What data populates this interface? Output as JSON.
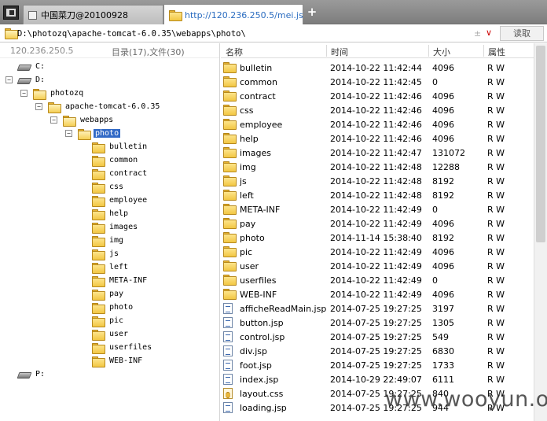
{
  "tabs": [
    {
      "label": "中国菜刀@20100928",
      "active": false
    },
    {
      "label": "http://120.236.250.5/mei.jsp",
      "active": true
    }
  ],
  "new_tab": "+",
  "path": {
    "value": "D:\\photozq\\apache-tomcat-6.0.35\\webapps\\photo\\",
    "separator": "±",
    "dropdown": "∨",
    "read_button": "读取"
  },
  "left_panel": {
    "ip": "120.236.250.5",
    "count": "目录(17),文件(30)",
    "tree": {
      "drive_c": "C:",
      "drive_d": "D:",
      "photozq": "photozq",
      "tomcat": "apache-tomcat-6.0.35",
      "webapps": "webapps",
      "photo": "photo",
      "children": [
        "bulletin",
        "common",
        "contract",
        "css",
        "employee",
        "help",
        "images",
        "img",
        "js",
        "left",
        "META-INF",
        "pay",
        "photo",
        "pic",
        "user",
        "userfiles",
        "WEB-INF"
      ],
      "drive_p": "P:"
    }
  },
  "columns": {
    "name": "名称",
    "time": "时间",
    "size": "大小",
    "attr": "属性"
  },
  "files": [
    {
      "name": "bulletin",
      "time": "2014-10-22 11:42:44",
      "size": "4096",
      "attr": "R W",
      "type": "folder"
    },
    {
      "name": "common",
      "time": "2014-10-22 11:42:45",
      "size": "0",
      "attr": "R W",
      "type": "folder"
    },
    {
      "name": "contract",
      "time": "2014-10-22 11:42:46",
      "size": "4096",
      "attr": "R W",
      "type": "folder"
    },
    {
      "name": "css",
      "time": "2014-10-22 11:42:46",
      "size": "4096",
      "attr": "R W",
      "type": "folder"
    },
    {
      "name": "employee",
      "time": "2014-10-22 11:42:46",
      "size": "4096",
      "attr": "R W",
      "type": "folder"
    },
    {
      "name": "help",
      "time": "2014-10-22 11:42:46",
      "size": "4096",
      "attr": "R W",
      "type": "folder"
    },
    {
      "name": "images",
      "time": "2014-10-22 11:42:47",
      "size": "131072",
      "attr": "R W",
      "type": "folder"
    },
    {
      "name": "img",
      "time": "2014-10-22 11:42:48",
      "size": "12288",
      "attr": "R W",
      "type": "folder"
    },
    {
      "name": "js",
      "time": "2014-10-22 11:42:48",
      "size": "8192",
      "attr": "R W",
      "type": "folder"
    },
    {
      "name": "left",
      "time": "2014-10-22 11:42:48",
      "size": "8192",
      "attr": "R W",
      "type": "folder"
    },
    {
      "name": "META-INF",
      "time": "2014-10-22 11:42:49",
      "size": "0",
      "attr": "R W",
      "type": "folder"
    },
    {
      "name": "pay",
      "time": "2014-10-22 11:42:49",
      "size": "4096",
      "attr": "R W",
      "type": "folder"
    },
    {
      "name": "photo",
      "time": "2014-11-14 15:38:40",
      "size": "8192",
      "attr": "R W",
      "type": "folder"
    },
    {
      "name": "pic",
      "time": "2014-10-22 11:42:49",
      "size": "4096",
      "attr": "R W",
      "type": "folder"
    },
    {
      "name": "user",
      "time": "2014-10-22 11:42:49",
      "size": "4096",
      "attr": "R W",
      "type": "folder"
    },
    {
      "name": "userfiles",
      "time": "2014-10-22 11:42:49",
      "size": "0",
      "attr": "R W",
      "type": "folder"
    },
    {
      "name": "WEB-INF",
      "time": "2014-10-22 11:42:49",
      "size": "4096",
      "attr": "R W",
      "type": "folder"
    },
    {
      "name": "afficheReadMain.jsp",
      "time": "2014-07-25 19:27:25",
      "size": "3197",
      "attr": "R W",
      "type": "file"
    },
    {
      "name": "button.jsp",
      "time": "2014-07-25 19:27:25",
      "size": "1305",
      "attr": "R W",
      "type": "file"
    },
    {
      "name": "control.jsp",
      "time": "2014-07-25 19:27:25",
      "size": "549",
      "attr": "R W",
      "type": "file"
    },
    {
      "name": "div.jsp",
      "time": "2014-07-25 19:27:25",
      "size": "6830",
      "attr": "R W",
      "type": "file"
    },
    {
      "name": "foot.jsp",
      "time": "2014-07-25 19:27:25",
      "size": "1733",
      "attr": "R W",
      "type": "file"
    },
    {
      "name": "index.jsp",
      "time": "2014-10-29 22:49:07",
      "size": "6111",
      "attr": "R W",
      "type": "file"
    },
    {
      "name": "layout.css",
      "time": "2014-07-25 19:27:25",
      "size": "840",
      "attr": "R W",
      "type": "css"
    },
    {
      "name": "loading.jsp",
      "time": "2014-07-25 19:27:25",
      "size": "944",
      "attr": "R W",
      "type": "file"
    }
  ],
  "watermark": "www.wooyun.org"
}
